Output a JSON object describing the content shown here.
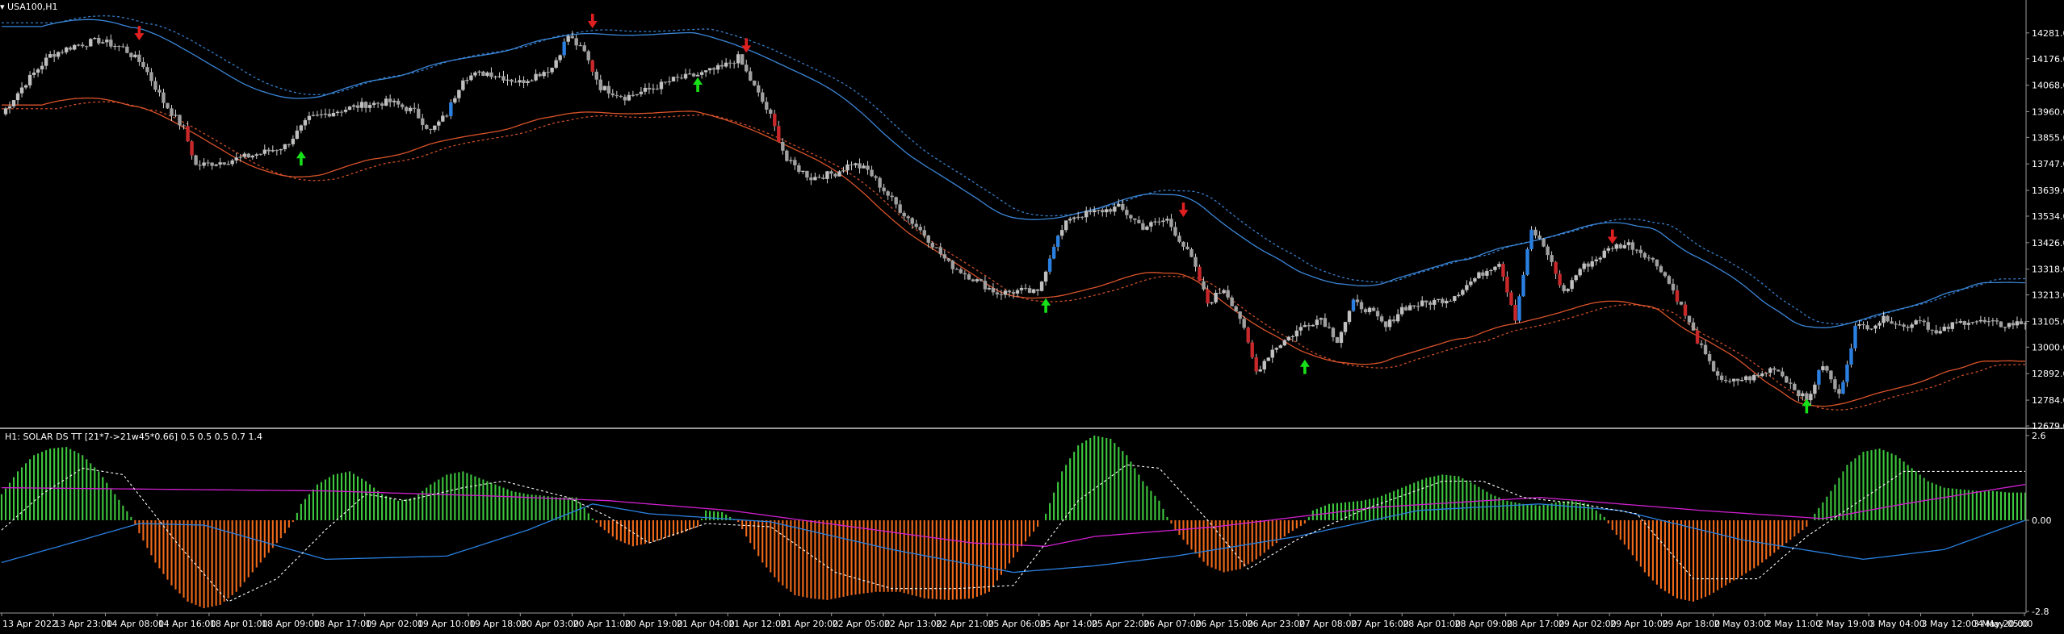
{
  "main_panel": {
    "title": "USA100,H1",
    "menu_icon": "triangle-down-icon"
  },
  "indicator_panel": {
    "title": "H1: SOLAR DS TT [21*7->21w45*0.66] 0.5 0.5 0.5 0.7 1.4"
  },
  "colors": {
    "background": "#000000",
    "axis_text": "#ffffff",
    "bull_candle": "#c0c0c0",
    "bear_candle": "#a0a0a0",
    "bull_highlight": "#2a7fe0",
    "bear_highlight": "#c8282a",
    "upper_band": "#3a86d8",
    "lower_band": "#d9532a",
    "hist_positive": "#3ec83e",
    "hist_negative": "#f06a1a",
    "magenta_line": "#d020d0",
    "blue_line": "#2a80e0",
    "dotted_line": "#ffffff",
    "up_arrow": "#18e018",
    "down_arrow": "#e02020"
  },
  "chart_data": [
    {
      "type": "candlestick",
      "symbol": "USA100",
      "timeframe": "H1",
      "ylim": [
        12679,
        14389
      ],
      "y_ticks": [
        "14281.0",
        "14176.0",
        "14068.0",
        "13960.0",
        "13855.0",
        "13747.0",
        "13639.0",
        "13534.0",
        "13426.0",
        "13318.0",
        "13213.0",
        "13105.0",
        "13000.0",
        "12892.0",
        "12784.0",
        "12679.0"
      ],
      "x_ticks": [
        "13 Apr 2022",
        "13 Apr 23:00",
        "14 Apr 08:00",
        "14 Apr 16:00",
        "18 Apr 01:00",
        "18 Apr 09:00",
        "18 Apr 17:00",
        "19 Apr 02:00",
        "19 Apr 10:00",
        "19 Apr 18:00",
        "20 Apr 03:00",
        "20 Apr 11:00",
        "20 Apr 19:00",
        "21 Apr 04:00",
        "21 Apr 12:00",
        "21 Apr 20:00",
        "22 Apr 05:00",
        "22 Apr 13:00",
        "22 Apr 21:00",
        "25 Apr 06:00",
        "25 Apr 14:00",
        "25 Apr 22:00",
        "26 Apr 07:00",
        "26 Apr 15:00",
        "26 Apr 23:00",
        "27 Apr 08:00",
        "27 Apr 16:00",
        "28 Apr 01:00",
        "28 Apr 09:00",
        "28 Apr 17:00",
        "29 Apr 02:00",
        "29 Apr 10:00",
        "29 Apr 18:00",
        "2 May 03:00",
        "2 May 11:00",
        "2 May 19:00",
        "3 May 04:00",
        "3 May 12:00",
        "3 May 20:00",
        "4 May 05:00"
      ],
      "price_path": [
        [
          0,
          13950
        ],
        [
          6,
          14080
        ],
        [
          12,
          14190
        ],
        [
          18,
          14230
        ],
        [
          24,
          14250
        ],
        [
          30,
          14220
        ],
        [
          35,
          14150
        ],
        [
          40,
          14000
        ],
        [
          45,
          13890
        ],
        [
          48,
          13740
        ],
        [
          56,
          13760
        ],
        [
          64,
          13790
        ],
        [
          70,
          13820
        ],
        [
          76,
          13930
        ],
        [
          82,
          13960
        ],
        [
          90,
          13990
        ],
        [
          96,
          14000
        ],
        [
          102,
          13960
        ],
        [
          106,
          13880
        ],
        [
          110,
          13950
        ],
        [
          114,
          14100
        ],
        [
          120,
          14120
        ],
        [
          128,
          14080
        ],
        [
          136,
          14140
        ],
        [
          140,
          14270
        ],
        [
          144,
          14200
        ],
        [
          148,
          14060
        ],
        [
          154,
          14020
        ],
        [
          160,
          14050
        ],
        [
          166,
          14090
        ],
        [
          172,
          14110
        ],
        [
          178,
          14140
        ],
        [
          182,
          14180
        ],
        [
          186,
          14060
        ],
        [
          190,
          13940
        ],
        [
          194,
          13760
        ],
        [
          200,
          13690
        ],
        [
          206,
          13710
        ],
        [
          210,
          13750
        ],
        [
          214,
          13720
        ],
        [
          218,
          13640
        ],
        [
          222,
          13560
        ],
        [
          228,
          13460
        ],
        [
          234,
          13340
        ],
        [
          240,
          13280
        ],
        [
          246,
          13220
        ],
        [
          252,
          13230
        ],
        [
          256,
          13220
        ],
        [
          260,
          13420
        ],
        [
          264,
          13530
        ],
        [
          270,
          13550
        ],
        [
          276,
          13570
        ],
        [
          282,
          13490
        ],
        [
          288,
          13520
        ],
        [
          294,
          13360
        ],
        [
          298,
          13180
        ],
        [
          302,
          13240
        ],
        [
          306,
          13120
        ],
        [
          310,
          12900
        ],
        [
          314,
          12990
        ],
        [
          318,
          13040
        ],
        [
          322,
          13090
        ],
        [
          326,
          13120
        ],
        [
          330,
          13030
        ],
        [
          334,
          13180
        ],
        [
          338,
          13150
        ],
        [
          342,
          13080
        ],
        [
          346,
          13160
        ],
        [
          352,
          13180
        ],
        [
          358,
          13200
        ],
        [
          364,
          13280
        ],
        [
          370,
          13350
        ],
        [
          374,
          13120
        ],
        [
          378,
          13480
        ],
        [
          382,
          13380
        ],
        [
          386,
          13220
        ],
        [
          390,
          13320
        ],
        [
          394,
          13360
        ],
        [
          398,
          13410
        ],
        [
          402,
          13420
        ],
        [
          406,
          13380
        ],
        [
          410,
          13320
        ],
        [
          414,
          13200
        ],
        [
          418,
          13060
        ],
        [
          422,
          12930
        ],
        [
          426,
          12850
        ],
        [
          430,
          12870
        ],
        [
          434,
          12880
        ],
        [
          438,
          12920
        ],
        [
          442,
          12850
        ],
        [
          446,
          12780
        ],
        [
          450,
          12930
        ],
        [
          454,
          12800
        ],
        [
          458,
          13080
        ],
        [
          462,
          13090
        ],
        [
          466,
          13120
        ],
        [
          470,
          13080
        ],
        [
          474,
          13120
        ],
        [
          478,
          13050
        ],
        [
          482,
          13090
        ],
        [
          486,
          13110
        ],
        [
          490,
          13100
        ],
        [
          494,
          13090
        ],
        [
          500,
          13100
        ]
      ],
      "down_arrows": [
        [
          34,
          14280
        ],
        [
          146,
          14330
        ],
        [
          184,
          14230
        ],
        [
          292,
          13560
        ],
        [
          398,
          13450
        ]
      ],
      "up_arrows": [
        [
          74,
          13770
        ],
        [
          172,
          14070
        ],
        [
          258,
          13170
        ],
        [
          322,
          12920
        ],
        [
          446,
          12760
        ]
      ]
    },
    {
      "type": "histogram-oscillator",
      "name": "SOLAR DS TT",
      "ylim": [
        -2.8,
        2.6
      ],
      "y_ticks": [
        "2.6",
        "0.00",
        "-2.8"
      ],
      "histogram": [
        [
          0,
          0.8
        ],
        [
          4,
          1.5
        ],
        [
          8,
          2.0
        ],
        [
          12,
          2.2
        ],
        [
          16,
          2.25
        ],
        [
          20,
          2.0
        ],
        [
          24,
          1.5
        ],
        [
          28,
          0.8
        ],
        [
          32,
          0.1
        ],
        [
          34,
          -0.4
        ],
        [
          38,
          -1.3
        ],
        [
          42,
          -2.0
        ],
        [
          46,
          -2.5
        ],
        [
          50,
          -2.7
        ],
        [
          54,
          -2.6
        ],
        [
          58,
          -2.2
        ],
        [
          62,
          -1.6
        ],
        [
          66,
          -1.0
        ],
        [
          70,
          -0.4
        ],
        [
          72,
          -0.05
        ],
        [
          74,
          0.5
        ],
        [
          78,
          1.1
        ],
        [
          82,
          1.4
        ],
        [
          86,
          1.5
        ],
        [
          90,
          1.2
        ],
        [
          94,
          0.8
        ],
        [
          98,
          0.6
        ],
        [
          102,
          0.7
        ],
        [
          106,
          1.1
        ],
        [
          110,
          1.4
        ],
        [
          114,
          1.5
        ],
        [
          118,
          1.3
        ],
        [
          122,
          1.1
        ],
        [
          126,
          0.9
        ],
        [
          130,
          0.8
        ],
        [
          134,
          0.75
        ],
        [
          138,
          0.7
        ],
        [
          142,
          0.7
        ],
        [
          146,
          0.05
        ],
        [
          148,
          -0.2
        ],
        [
          152,
          -0.6
        ],
        [
          156,
          -0.8
        ],
        [
          160,
          -0.7
        ],
        [
          164,
          -0.55
        ],
        [
          168,
          -0.4
        ],
        [
          172,
          -0.2
        ],
        [
          174,
          0.3
        ],
        [
          178,
          0.25
        ],
        [
          182,
          -0.05
        ],
        [
          184,
          -0.5
        ],
        [
          188,
          -1.3
        ],
        [
          192,
          -1.9
        ],
        [
          196,
          -2.3
        ],
        [
          200,
          -2.4
        ],
        [
          204,
          -2.45
        ],
        [
          210,
          -2.3
        ],
        [
          216,
          -2.2
        ],
        [
          222,
          -2.2
        ],
        [
          228,
          -2.4
        ],
        [
          234,
          -2.45
        ],
        [
          240,
          -2.4
        ],
        [
          244,
          -2.2
        ],
        [
          248,
          -1.5
        ],
        [
          252,
          -0.8
        ],
        [
          256,
          -0.2
        ],
        [
          258,
          0.2
        ],
        [
          262,
          1.5
        ],
        [
          266,
          2.3
        ],
        [
          270,
          2.6
        ],
        [
          274,
          2.5
        ],
        [
          278,
          2.0
        ],
        [
          282,
          1.2
        ],
        [
          286,
          0.6
        ],
        [
          288,
          0.1
        ],
        [
          290,
          -0.3
        ],
        [
          294,
          -0.9
        ],
        [
          298,
          -1.4
        ],
        [
          302,
          -1.6
        ],
        [
          306,
          -1.5
        ],
        [
          310,
          -1.2
        ],
        [
          314,
          -0.8
        ],
        [
          318,
          -0.4
        ],
        [
          322,
          -0.1
        ],
        [
          324,
          0.3
        ],
        [
          328,
          0.5
        ],
        [
          332,
          0.55
        ],
        [
          336,
          0.6
        ],
        [
          340,
          0.7
        ],
        [
          344,
          0.9
        ],
        [
          348,
          1.1
        ],
        [
          352,
          1.3
        ],
        [
          356,
          1.4
        ],
        [
          360,
          1.35
        ],
        [
          364,
          1.1
        ],
        [
          368,
          0.8
        ],
        [
          372,
          0.6
        ],
        [
          376,
          0.5
        ],
        [
          380,
          0.45
        ],
        [
          384,
          0.55
        ],
        [
          388,
          0.6
        ],
        [
          392,
          0.5
        ],
        [
          396,
          0.1
        ],
        [
          398,
          -0.3
        ],
        [
          402,
          -0.9
        ],
        [
          406,
          -1.6
        ],
        [
          410,
          -2.1
        ],
        [
          414,
          -2.4
        ],
        [
          418,
          -2.5
        ],
        [
          422,
          -2.3
        ],
        [
          426,
          -2.0
        ],
        [
          430,
          -1.7
        ],
        [
          434,
          -1.4
        ],
        [
          438,
          -1.0
        ],
        [
          442,
          -0.6
        ],
        [
          446,
          -0.2
        ],
        [
          448,
          0.2
        ],
        [
          452,
          0.9
        ],
        [
          456,
          1.7
        ],
        [
          460,
          2.1
        ],
        [
          464,
          2.2
        ],
        [
          468,
          2.0
        ],
        [
          472,
          1.6
        ],
        [
          476,
          1.2
        ],
        [
          480,
          1.0
        ],
        [
          484,
          0.95
        ],
        [
          488,
          0.9
        ],
        [
          492,
          0.9
        ],
        [
          496,
          0.85
        ],
        [
          500,
          0.85
        ]
      ],
      "magenta_line": [
        [
          0,
          1.0
        ],
        [
          40,
          0.95
        ],
        [
          80,
          0.9
        ],
        [
          120,
          0.75
        ],
        [
          150,
          0.6
        ],
        [
          180,
          0.3
        ],
        [
          210,
          -0.2
        ],
        [
          240,
          -0.7
        ],
        [
          258,
          -0.8
        ],
        [
          270,
          -0.5
        ],
        [
          300,
          -0.2
        ],
        [
          340,
          0.4
        ],
        [
          380,
          0.7
        ],
        [
          420,
          0.3
        ],
        [
          450,
          0.05
        ],
        [
          470,
          0.5
        ],
        [
          500,
          1.1
        ]
      ],
      "blue_line": [
        [
          0,
          -1.3
        ],
        [
          20,
          -0.6
        ],
        [
          34,
          -0.1
        ],
        [
          50,
          -0.15
        ],
        [
          80,
          -1.2
        ],
        [
          110,
          -1.1
        ],
        [
          130,
          -0.3
        ],
        [
          146,
          0.5
        ],
        [
          160,
          0.2
        ],
        [
          190,
          -0.05
        ],
        [
          220,
          -0.9
        ],
        [
          250,
          -1.6
        ],
        [
          270,
          -1.4
        ],
        [
          290,
          -1.1
        ],
        [
          320,
          -0.5
        ],
        [
          350,
          0.3
        ],
        [
          380,
          0.5
        ],
        [
          400,
          0.3
        ],
        [
          430,
          -0.6
        ],
        [
          460,
          -1.2
        ],
        [
          480,
          -0.9
        ],
        [
          500,
          0.0
        ]
      ],
      "dotted_line": [
        [
          0,
          -0.3
        ],
        [
          10,
          0.8
        ],
        [
          20,
          1.6
        ],
        [
          30,
          1.4
        ],
        [
          44,
          -0.8
        ],
        [
          56,
          -2.5
        ],
        [
          68,
          -1.8
        ],
        [
          80,
          -0.3
        ],
        [
          90,
          0.8
        ],
        [
          100,
          0.6
        ],
        [
          114,
          1.0
        ],
        [
          124,
          1.2
        ],
        [
          140,
          0.7
        ],
        [
          150,
          0.1
        ],
        [
          160,
          -0.7
        ],
        [
          174,
          -0.1
        ],
        [
          190,
          -0.2
        ],
        [
          206,
          -1.6
        ],
        [
          220,
          -2.1
        ],
        [
          236,
          -2.1
        ],
        [
          250,
          -2.0
        ],
        [
          266,
          0.6
        ],
        [
          278,
          1.7
        ],
        [
          286,
          1.6
        ],
        [
          298,
          0.0
        ],
        [
          308,
          -1.5
        ],
        [
          320,
          -0.6
        ],
        [
          336,
          0.3
        ],
        [
          356,
          1.2
        ],
        [
          366,
          1.2
        ],
        [
          376,
          0.7
        ],
        [
          390,
          0.5
        ],
        [
          404,
          0.2
        ],
        [
          418,
          -1.8
        ],
        [
          434,
          -1.8
        ],
        [
          446,
          -0.5
        ],
        [
          458,
          0.5
        ],
        [
          470,
          1.5
        ],
        [
          500,
          1.5
        ]
      ]
    }
  ]
}
